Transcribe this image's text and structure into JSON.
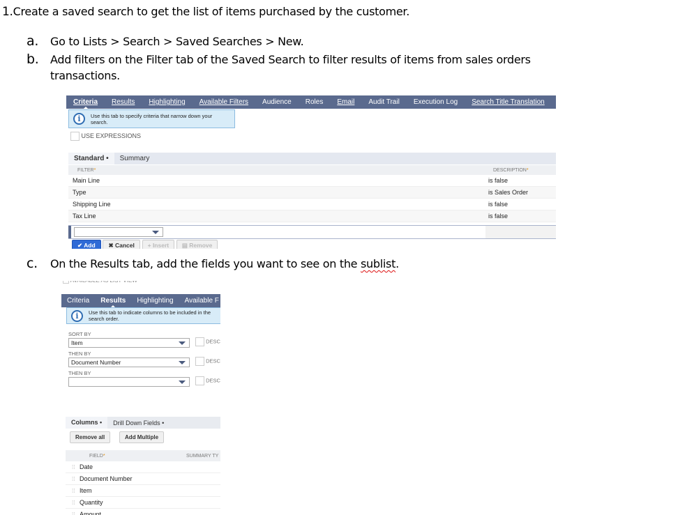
{
  "document": {
    "step1": {
      "number": "1.",
      "text": "Create a saved search to get the list of items purchased by the customer."
    },
    "step_a": {
      "letter": "a.",
      "text": "Go to Lists > Search > Saved Searches > New."
    },
    "step_b": {
      "letter": "b.",
      "text": "Add filters on the Filter tab of the Saved Search to filter results of items from sales orders transactions."
    },
    "step_c": {
      "letter": "c.",
      "text_before": "On the Results tab, add the fields you want to see on the ",
      "text_spell": "sublist",
      "text_after": "."
    }
  },
  "criteria_screen": {
    "tabs": [
      {
        "label": "Criteria",
        "active": true
      },
      {
        "label": "Results"
      },
      {
        "label": "Highlighting"
      },
      {
        "label": "Available Filters"
      },
      {
        "label": "Audience"
      },
      {
        "label": "Roles"
      },
      {
        "label": "Email"
      },
      {
        "label": "Audit Trail"
      },
      {
        "label": "Execution Log"
      },
      {
        "label": "Search Title Translation"
      }
    ],
    "info_text": "Use this tab to specify criteria that narrow down your search.",
    "use_expressions_label": "USE EXPRESSIONS",
    "subtabs": [
      {
        "label": "Standard •",
        "active": true
      },
      {
        "label": "Summary"
      }
    ],
    "columns": {
      "filter": "FILTER",
      "description": "DESCRIPTION"
    },
    "rows": [
      {
        "filter": "Main Line",
        "description": "is false"
      },
      {
        "filter": "Type",
        "description": "is Sales Order"
      },
      {
        "filter": "Shipping Line",
        "description": "is false"
      },
      {
        "filter": "Tax Line",
        "description": "is false"
      }
    ],
    "new_row_value": "",
    "buttons": {
      "add": "✔ Add",
      "cancel": "✖ Cancel",
      "insert": "+ Insert",
      "remove": "▤ Remove"
    }
  },
  "results_screen": {
    "top_cut_label": "AVAILABLE AS LIST VIEW",
    "tabs": [
      {
        "label": "Criteria"
      },
      {
        "label": "Results",
        "active": true
      },
      {
        "label": "Highlighting"
      },
      {
        "label": "Available F"
      }
    ],
    "info_text": "Use this tab to indicate columns to be included in the search order.",
    "sort": [
      {
        "label": "SORT BY",
        "value": "Item",
        "desc_label": "DESC"
      },
      {
        "label": "THEN BY",
        "value": "Document Number",
        "desc_label": "DESC"
      },
      {
        "label": "THEN BY",
        "value": "",
        "desc_label": "DESC"
      }
    ],
    "subtabs": [
      {
        "label": "Columns •",
        "active": true
      },
      {
        "label": "Drill Down Fields •"
      }
    ],
    "buttons": {
      "remove_all": "Remove all",
      "add_multiple": "Add Multiple"
    },
    "columns": {
      "field": "FIELD",
      "summary_type": "SUMMARY TY"
    },
    "fields": [
      "Date",
      "Document Number",
      "Item",
      "Quantity",
      "Amount"
    ]
  }
}
